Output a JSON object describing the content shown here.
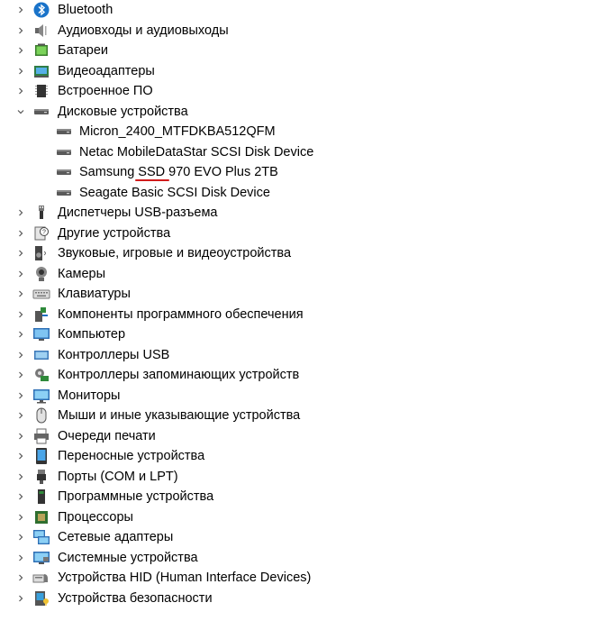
{
  "tree": {
    "items": [
      {
        "label": "Bluetooth",
        "icon": "bluetooth-icon",
        "expanded": false
      },
      {
        "label": "Аудиовходы и аудиовыходы",
        "icon": "speaker-icon",
        "expanded": false
      },
      {
        "label": "Батареи",
        "icon": "battery-icon",
        "expanded": false
      },
      {
        "label": "Видеоадаптеры",
        "icon": "display-adapter-icon",
        "expanded": false
      },
      {
        "label": "Встроенное ПО",
        "icon": "firmware-chip-icon",
        "expanded": false
      },
      {
        "label": "Дисковые устройства",
        "icon": "disk-drive-icon",
        "expanded": true,
        "children": [
          {
            "label": "Micron_2400_MTFDKBA512QFM",
            "icon": "disk-drive-icon"
          },
          {
            "label": "Netac MobileDataStar SCSI Disk Device",
            "icon": "disk-drive-icon"
          },
          {
            "label": "Samsung SSD 970 EVO Plus 2TB",
            "icon": "disk-drive-icon",
            "annotation": "SSD"
          },
          {
            "label": "Seagate Basic SCSI Disk Device",
            "icon": "disk-drive-icon"
          }
        ]
      },
      {
        "label": "Диспетчеры USB-разъема",
        "icon": "usb-connector-icon",
        "expanded": false
      },
      {
        "label": "Другие устройства",
        "icon": "unknown-device-icon",
        "expanded": false
      },
      {
        "label": "Звуковые, игровые и видеоустройства",
        "icon": "sound-device-icon",
        "expanded": false
      },
      {
        "label": "Камеры",
        "icon": "camera-icon",
        "expanded": false
      },
      {
        "label": "Клавиатуры",
        "icon": "keyboard-icon",
        "expanded": false
      },
      {
        "label": "Компоненты программного обеспечения",
        "icon": "software-component-icon",
        "expanded": false
      },
      {
        "label": "Компьютер",
        "icon": "computer-icon",
        "expanded": false
      },
      {
        "label": "Контроллеры USB",
        "icon": "usb-controller-icon",
        "expanded": false
      },
      {
        "label": "Контроллеры запоминающих устройств",
        "icon": "storage-controller-icon",
        "expanded": false
      },
      {
        "label": "Мониторы",
        "icon": "monitor-icon",
        "expanded": false
      },
      {
        "label": "Мыши и иные указывающие устройства",
        "icon": "mouse-icon",
        "expanded": false
      },
      {
        "label": "Очереди печати",
        "icon": "printer-icon",
        "expanded": false
      },
      {
        "label": "Переносные устройства",
        "icon": "portable-device-icon",
        "expanded": false
      },
      {
        "label": "Порты (COM и LPT)",
        "icon": "port-icon",
        "expanded": false
      },
      {
        "label": "Программные устройства",
        "icon": "software-device-icon",
        "expanded": false
      },
      {
        "label": "Процессоры",
        "icon": "processor-icon",
        "expanded": false
      },
      {
        "label": "Сетевые адаптеры",
        "icon": "network-adapter-icon",
        "expanded": false
      },
      {
        "label": "Системные устройства",
        "icon": "system-device-icon",
        "expanded": false
      },
      {
        "label": "Устройства HID (Human Interface Devices)",
        "icon": "hid-device-icon",
        "expanded": false
      },
      {
        "label": "Устройства безопасности",
        "icon": "security-device-icon",
        "expanded": false
      }
    ]
  },
  "colors": {
    "annotation_underline": "#d11b1b",
    "chevron": "#555555",
    "text": "#000000"
  }
}
